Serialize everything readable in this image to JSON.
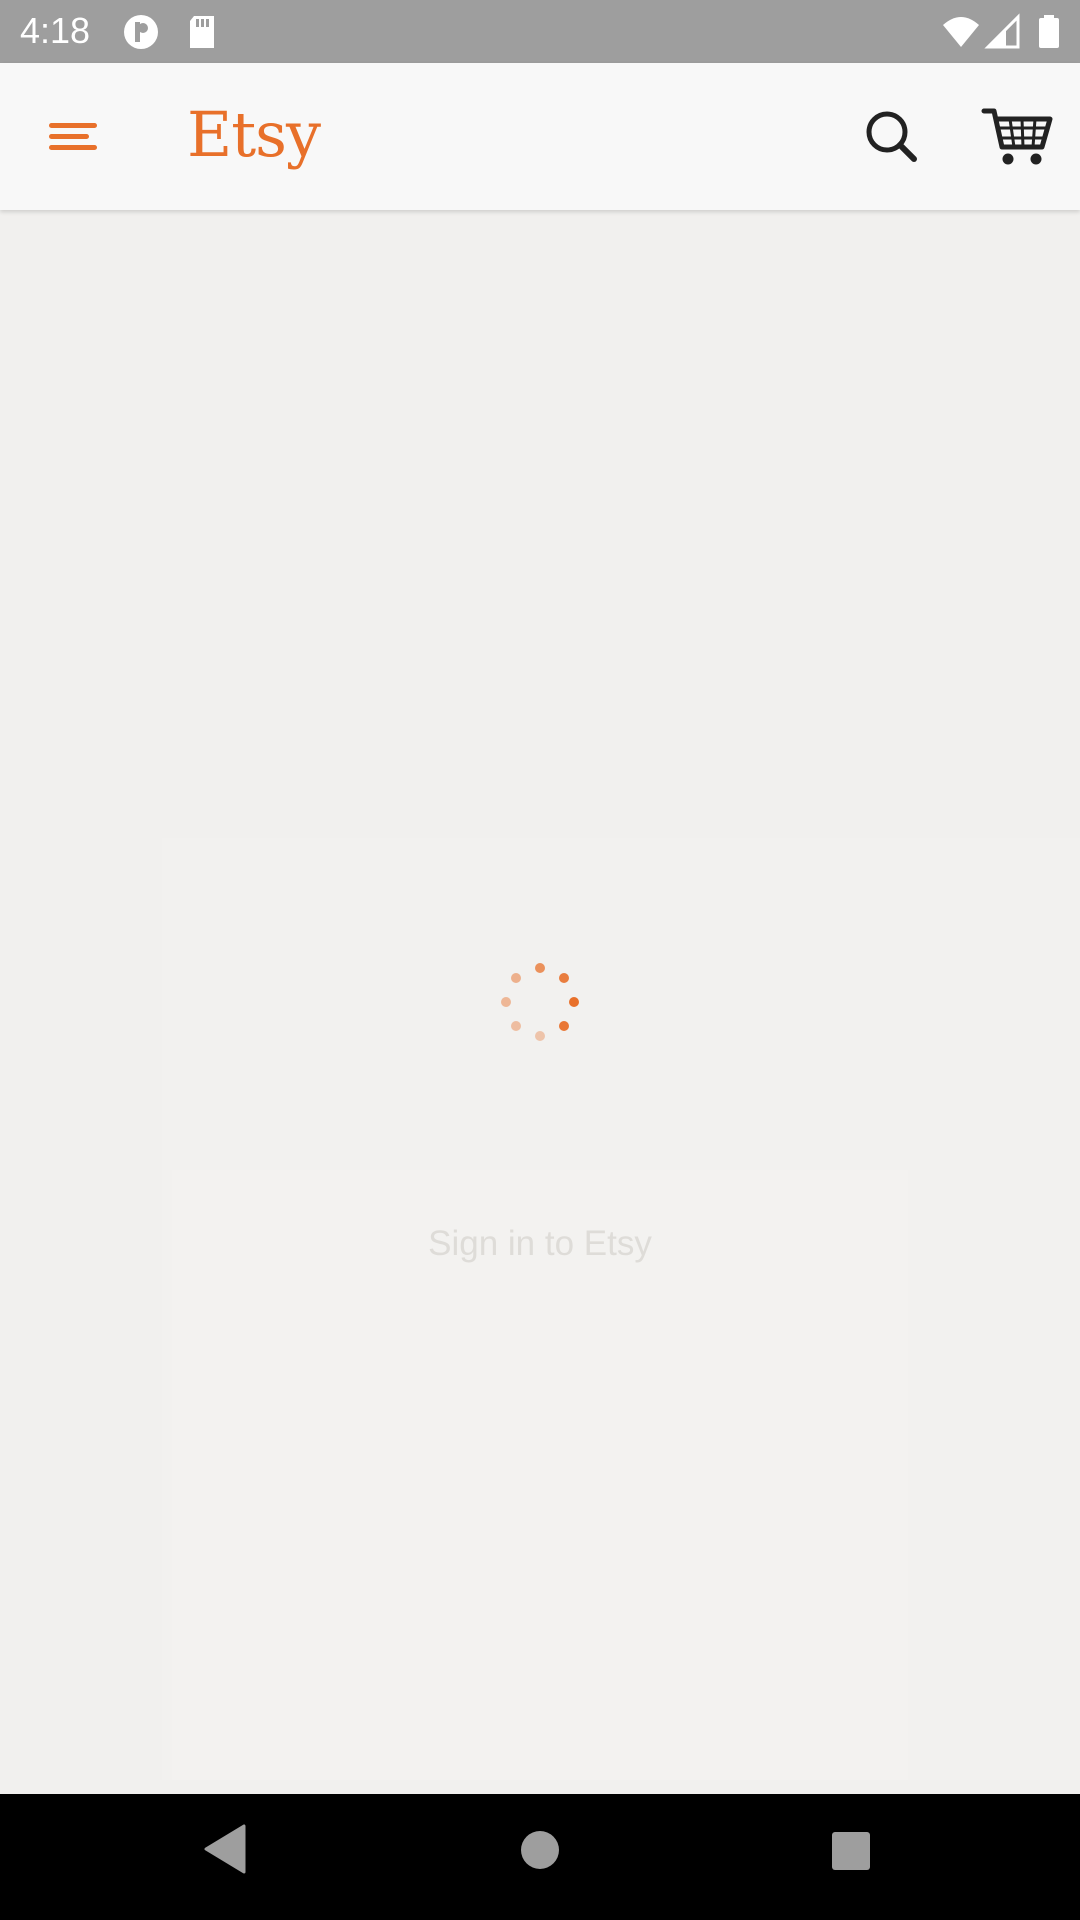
{
  "status_bar": {
    "time": "4:18",
    "icons": [
      "circle-logo-icon",
      "sd-card-icon",
      "wifi-icon",
      "signal-icon",
      "battery-icon"
    ]
  },
  "app_bar": {
    "logo_text": "Etsy",
    "brand_color": "#e8702a",
    "icons": [
      "menu-icon",
      "search-icon",
      "cart-icon"
    ]
  },
  "main": {
    "loading": true,
    "signin_title": "Sign in to Etsy"
  },
  "nav_bar": {
    "icons": [
      "back-icon",
      "home-icon",
      "recents-icon"
    ]
  }
}
